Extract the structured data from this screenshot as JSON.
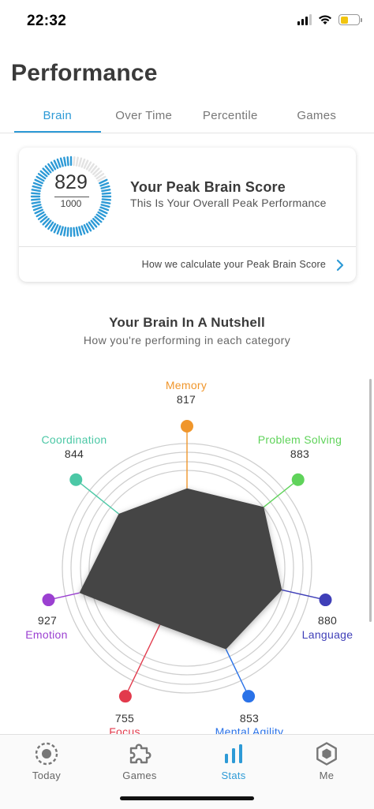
{
  "status_bar": {
    "time": "22:32"
  },
  "header": {
    "title": "Performance"
  },
  "tabs": [
    {
      "label": "Brain",
      "active": true
    },
    {
      "label": "Over Time",
      "active": false
    },
    {
      "label": "Percentile",
      "active": false
    },
    {
      "label": "Games",
      "active": false
    }
  ],
  "peak_card": {
    "score": "829",
    "max": "1000",
    "score_fraction": 0.829,
    "title": "Your Peak Brain Score",
    "subtitle": "This Is Your Overall Peak Performance",
    "link_label": "How we calculate your Peak Brain Score"
  },
  "nutshell": {
    "title": "Your Brain In A Nutshell",
    "subtitle": "How you're performing in each category"
  },
  "categories": [
    {
      "name": "Memory",
      "score": "817",
      "color": "#f0962b"
    },
    {
      "name": "Problem Solving",
      "score": "883",
      "color": "#5fd35a"
    },
    {
      "name": "Language",
      "score": "880",
      "color": "#3f3fb8"
    },
    {
      "name": "Mental Agility",
      "score": "853",
      "color": "#2a72e8"
    },
    {
      "name": "Focus",
      "score": "755",
      "color": "#e23a4c"
    },
    {
      "name": "Emotion",
      "score": "927",
      "color": "#9b40d1"
    },
    {
      "name": "Coordination",
      "score": "844",
      "color": "#4cc8a6"
    }
  ],
  "colors": {
    "accent": "#2d9ad6",
    "ring_track": "#e3e3e3",
    "shape_fill": "#444444"
  },
  "bottom_nav": [
    {
      "label": "Today",
      "icon": "target-icon",
      "active": false
    },
    {
      "label": "Games",
      "icon": "puzzle-icon",
      "active": false
    },
    {
      "label": "Stats",
      "icon": "bar-chart-icon",
      "active": true
    },
    {
      "label": "Me",
      "icon": "hexagon-profile-icon",
      "active": false
    }
  ]
}
